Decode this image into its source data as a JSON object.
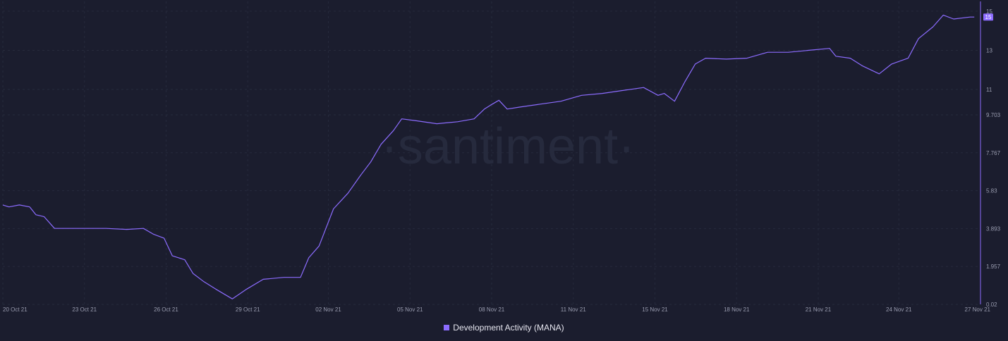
{
  "watermark": "santiment",
  "chart_data": {
    "type": "line",
    "series": [
      {
        "name": "Development Activity (MANA)",
        "color": "#8c6cff",
        "points": [
          [
            0,
            5.1
          ],
          [
            0.3,
            5.0
          ],
          [
            0.8,
            5.1
          ],
          [
            1.3,
            5.0
          ],
          [
            1.6,
            4.6
          ],
          [
            2.0,
            4.5
          ],
          [
            2.5,
            3.9
          ],
          [
            3.0,
            3.9
          ],
          [
            4.0,
            3.9
          ],
          [
            5.0,
            3.9
          ],
          [
            6.0,
            3.85
          ],
          [
            6.8,
            3.9
          ],
          [
            7.3,
            3.6
          ],
          [
            7.8,
            3.4
          ],
          [
            8.2,
            2.5
          ],
          [
            8.8,
            2.3
          ],
          [
            9.2,
            1.6
          ],
          [
            9.7,
            1.2
          ],
          [
            10.3,
            0.8
          ],
          [
            11.1,
            0.3
          ],
          [
            11.8,
            0.8
          ],
          [
            12.6,
            1.3
          ],
          [
            13.6,
            1.4
          ],
          [
            14.4,
            1.4
          ],
          [
            14.8,
            2.4
          ],
          [
            15.3,
            3.0
          ],
          [
            16.0,
            4.9
          ],
          [
            16.7,
            5.7
          ],
          [
            17.3,
            6.6
          ],
          [
            17.8,
            7.3
          ],
          [
            18.3,
            8.2
          ],
          [
            18.9,
            8.9
          ],
          [
            19.3,
            9.5
          ],
          [
            20.0,
            9.4
          ],
          [
            21.0,
            9.25
          ],
          [
            22.0,
            9.35
          ],
          [
            22.8,
            9.5
          ],
          [
            23.3,
            10.0
          ],
          [
            23.6,
            10.2
          ],
          [
            24.0,
            10.45
          ],
          [
            24.4,
            10.0
          ],
          [
            25.0,
            10.1
          ],
          [
            26.0,
            10.25
          ],
          [
            27.0,
            10.4
          ],
          [
            28.0,
            10.7
          ],
          [
            29.0,
            10.8
          ],
          [
            30.0,
            10.95
          ],
          [
            31.0,
            11.1
          ],
          [
            31.7,
            10.7
          ],
          [
            32.0,
            10.8
          ],
          [
            32.5,
            10.4
          ],
          [
            33.0,
            11.4
          ],
          [
            33.5,
            12.3
          ],
          [
            34.0,
            12.6
          ],
          [
            35.0,
            12.55
          ],
          [
            36.0,
            12.6
          ],
          [
            37.0,
            12.9
          ],
          [
            38.0,
            12.9
          ],
          [
            39.0,
            13.0
          ],
          [
            40.0,
            13.1
          ],
          [
            40.3,
            12.7
          ],
          [
            41.0,
            12.6
          ],
          [
            41.6,
            12.2
          ],
          [
            42.4,
            11.8
          ],
          [
            43.0,
            12.3
          ],
          [
            43.8,
            12.6
          ],
          [
            44.3,
            13.6
          ],
          [
            45.0,
            14.2
          ],
          [
            45.5,
            14.8
          ],
          [
            46.0,
            14.6
          ],
          [
            46.8,
            14.7
          ],
          [
            47.0,
            14.7
          ]
        ]
      }
    ],
    "x_ticks": [
      {
        "x": 0,
        "label": "20 Oct 21"
      },
      {
        "x": 3.95,
        "label": "23 Oct 21"
      },
      {
        "x": 7.9,
        "label": "26 Oct 21"
      },
      {
        "x": 11.85,
        "label": "29 Oct 21"
      },
      {
        "x": 15.75,
        "label": "02 Nov 21"
      },
      {
        "x": 19.7,
        "label": "05 Nov 21"
      },
      {
        "x": 23.65,
        "label": "08 Nov 21"
      },
      {
        "x": 27.6,
        "label": "11 Nov 21"
      },
      {
        "x": 31.55,
        "label": "15 Nov 21"
      },
      {
        "x": 35.5,
        "label": "18 Nov 21"
      },
      {
        "x": 39.45,
        "label": "21 Nov 21"
      },
      {
        "x": 43.35,
        "label": "24 Nov 21"
      },
      {
        "x": 47.3,
        "label": "27 Nov 21"
      }
    ],
    "y_ticks": [
      {
        "y": 0.02,
        "label": "0.02"
      },
      {
        "y": 1.957,
        "label": "1.957"
      },
      {
        "y": 3.893,
        "label": "3.893"
      },
      {
        "y": 5.83,
        "label": "5.83"
      },
      {
        "y": 7.767,
        "label": "7.767"
      },
      {
        "y": 9.703,
        "label": "9.703"
      },
      {
        "y": 11,
        "label": "11"
      },
      {
        "y": 13,
        "label": "13"
      },
      {
        "y": 15,
        "label": "15"
      }
    ],
    "last_value_label": "15",
    "xlim": [
      0,
      47.3
    ],
    "ylim": [
      0.02,
      15.5
    ],
    "grid": true,
    "legend_position": "bottom-center"
  }
}
